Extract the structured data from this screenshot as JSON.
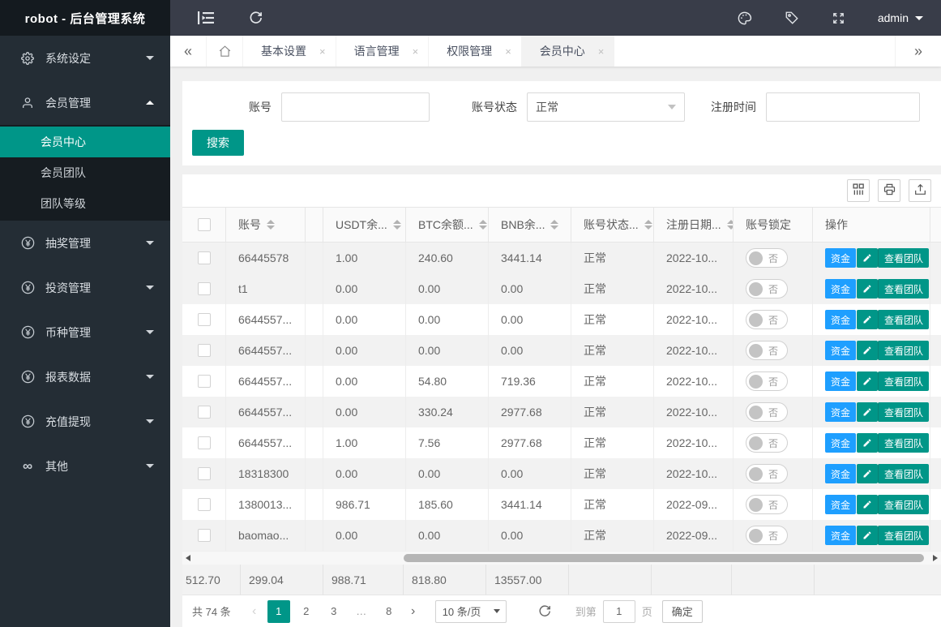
{
  "app": {
    "title": "robot - 后台管理系统",
    "user": "admin"
  },
  "navbar": {
    "left_icons": [
      {
        "name": "collapse-menu-icon"
      },
      {
        "name": "refresh-icon"
      }
    ],
    "right_icons": [
      {
        "name": "theme-icon"
      },
      {
        "name": "tag-icon"
      },
      {
        "name": "fullscreen-icon"
      }
    ]
  },
  "sidebar": {
    "items": [
      {
        "key": "system-settings",
        "label": "系统设定",
        "icon": "gear-icon",
        "expanded": false
      },
      {
        "key": "member-management",
        "label": "会员管理",
        "icon": "user-icon",
        "expanded": true,
        "children": [
          {
            "key": "member-center",
            "label": "会员中心",
            "active": true
          },
          {
            "key": "member-team",
            "label": "会员团队",
            "active": false
          },
          {
            "key": "team-level",
            "label": "团队等级",
            "active": false
          }
        ]
      },
      {
        "key": "lottery-management",
        "label": "抽奖管理",
        "icon": "yen-icon",
        "expanded": false
      },
      {
        "key": "investment-management",
        "label": "投资管理",
        "icon": "yen-icon",
        "expanded": false
      },
      {
        "key": "currency-management",
        "label": "币种管理",
        "icon": "yen-icon",
        "expanded": false
      },
      {
        "key": "report-data",
        "label": "报表数据",
        "icon": "yen-icon",
        "expanded": false
      },
      {
        "key": "recharge-withdraw",
        "label": "充值提现",
        "icon": "yen-icon",
        "expanded": false
      },
      {
        "key": "other",
        "label": "其他",
        "icon": "infinity-icon",
        "expanded": false
      }
    ]
  },
  "tabbar": {
    "tabs": [
      {
        "key": "basic-settings",
        "label": "基本设置",
        "active": false
      },
      {
        "key": "language-management",
        "label": "语言管理",
        "active": false
      },
      {
        "key": "permission-management",
        "label": "权限管理",
        "active": false
      },
      {
        "key": "member-center",
        "label": "会员中心",
        "active": true
      }
    ]
  },
  "search": {
    "account_label": "账号",
    "account_value": "",
    "status_label": "账号状态",
    "status_value": "正常",
    "register_label": "注册时间",
    "register_value": "",
    "button": "搜索"
  },
  "table": {
    "toolbar_icons": [
      {
        "name": "columns-icon"
      },
      {
        "name": "print-icon"
      },
      {
        "name": "export-icon"
      }
    ],
    "columns": [
      {
        "key": "checkbox",
        "label": "",
        "sortable": false
      },
      {
        "key": "account",
        "label": "账号",
        "sortable": true
      },
      {
        "key": "truncated",
        "label": "",
        "sortable": true
      },
      {
        "key": "usdt",
        "label": "USDT余...",
        "sortable": true
      },
      {
        "key": "btc",
        "label": "BTC余额...",
        "sortable": true
      },
      {
        "key": "bnb",
        "label": "BNB余...",
        "sortable": true
      },
      {
        "key": "status",
        "label": "账号状态...",
        "sortable": true
      },
      {
        "key": "date",
        "label": "注册日期...",
        "sortable": true
      },
      {
        "key": "lock",
        "label": "账号锁定",
        "sortable": false
      },
      {
        "key": "actions",
        "label": "操作",
        "sortable": false
      }
    ],
    "rows": [
      {
        "account": "66445578",
        "usdt": "1.00",
        "btc": "240.60",
        "bnb": "3441.14",
        "status": "正常",
        "date": "2022-10...",
        "lock": "否"
      },
      {
        "account": "t1",
        "usdt": "0.00",
        "btc": "0.00",
        "bnb": "0.00",
        "status": "正常",
        "date": "2022-10...",
        "lock": "否"
      },
      {
        "account": "6644557...",
        "usdt": "0.00",
        "btc": "0.00",
        "bnb": "0.00",
        "status": "正常",
        "date": "2022-10...",
        "lock": "否"
      },
      {
        "account": "6644557...",
        "usdt": "0.00",
        "btc": "0.00",
        "bnb": "0.00",
        "status": "正常",
        "date": "2022-10...",
        "lock": "否"
      },
      {
        "account": "6644557...",
        "usdt": "0.00",
        "btc": "54.80",
        "bnb": "719.36",
        "status": "正常",
        "date": "2022-10...",
        "lock": "否"
      },
      {
        "account": "6644557...",
        "usdt": "0.00",
        "btc": "330.24",
        "bnb": "2977.68",
        "status": "正常",
        "date": "2022-10...",
        "lock": "否"
      },
      {
        "account": "6644557...",
        "usdt": "1.00",
        "btc": "7.56",
        "bnb": "2977.68",
        "status": "正常",
        "date": "2022-10...",
        "lock": "否"
      },
      {
        "account": "18318300",
        "usdt": "0.00",
        "btc": "0.00",
        "bnb": "0.00",
        "status": "正常",
        "date": "2022-10...",
        "lock": "否"
      },
      {
        "account": "1380013...",
        "usdt": "986.71",
        "btc": "185.60",
        "bnb": "3441.14",
        "status": "正常",
        "date": "2022-09...",
        "lock": "否"
      },
      {
        "account": "baomao...",
        "usdt": "0.00",
        "btc": "0.00",
        "bnb": "0.00",
        "status": "正常",
        "date": "2022-09...",
        "lock": "否"
      }
    ],
    "actions": {
      "fund": "资金",
      "edit_icon": "edit-icon",
      "view_team": "查看团队"
    },
    "totals": [
      "512.70",
      "299.04",
      "988.71",
      "818.80",
      "13557.00",
      "",
      "",
      "",
      ""
    ]
  },
  "pagination": {
    "total": "共 74 条",
    "pages": [
      "1",
      "2",
      "3",
      "...",
      "8"
    ],
    "current": "1",
    "page_size": "10 条/页",
    "goto_label": "到第",
    "goto_value": "1",
    "page_unit": "页",
    "confirm": "确定"
  },
  "colors": {
    "accent": "#009688",
    "blue": "#1E9FFF"
  }
}
